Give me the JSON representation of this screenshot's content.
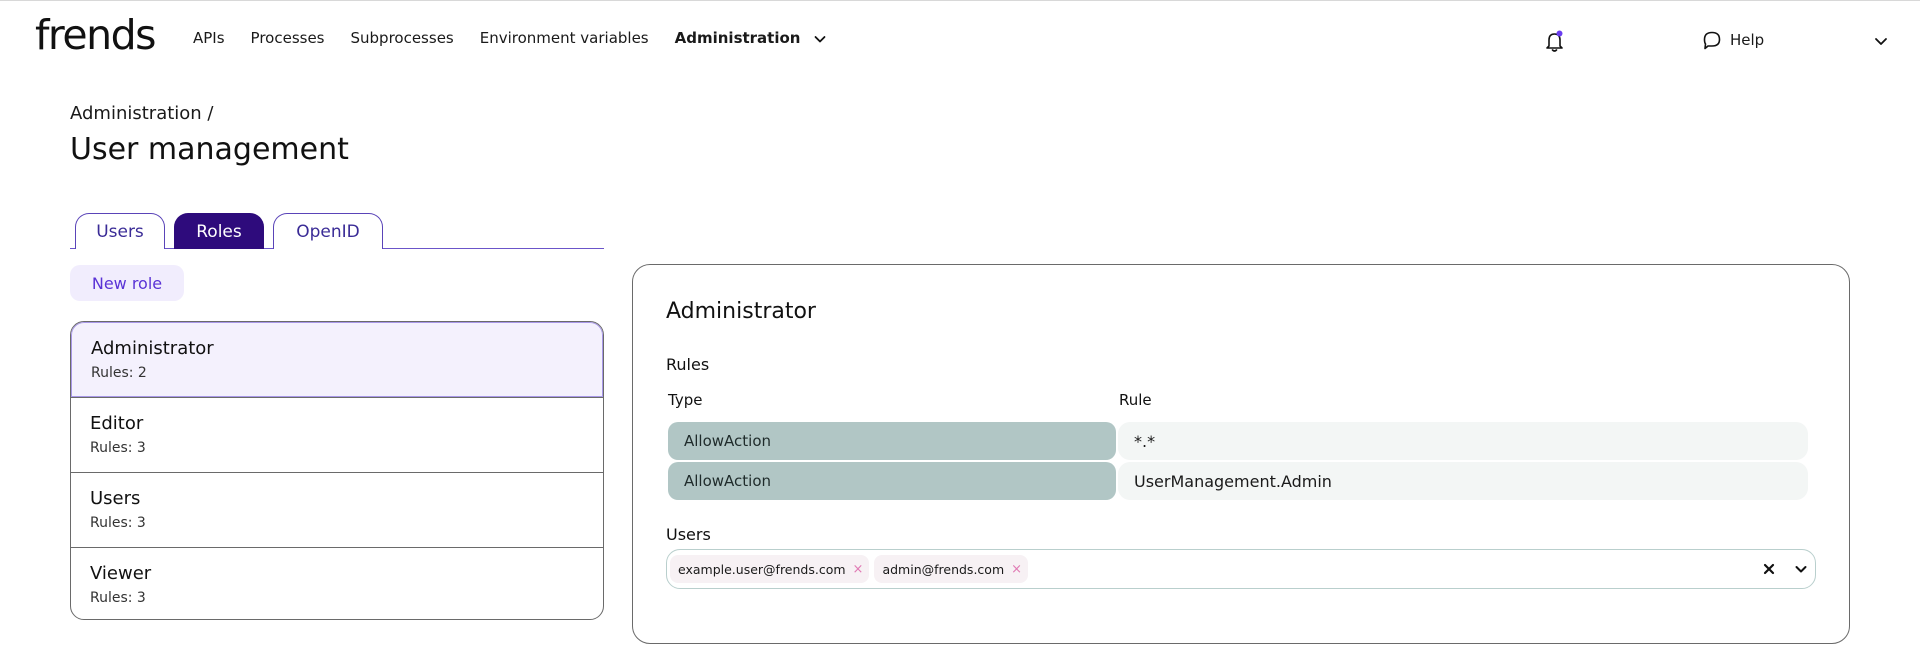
{
  "header": {
    "logo": "frends",
    "nav": [
      {
        "label": "APIs"
      },
      {
        "label": "Processes"
      },
      {
        "label": "Subprocesses"
      },
      {
        "label": "Environment variables"
      },
      {
        "label": "Administration",
        "active": true
      }
    ],
    "nav_dropdown_icon": "chevron-down-icon",
    "notification_icon": "bell-icon",
    "help_icon": "speech-bubble-icon",
    "help_label": "Help",
    "account_menu_icon": "chevron-down-icon"
  },
  "page": {
    "breadcrumb": "Administration /",
    "title": "User management"
  },
  "tabs": [
    {
      "label": "Users"
    },
    {
      "label": "Roles",
      "active": true
    },
    {
      "label": "OpenID"
    }
  ],
  "new_role_label": "New role",
  "roles": [
    {
      "name": "Administrator",
      "rules": "Rules: 2",
      "selected": true
    },
    {
      "name": "Editor",
      "rules": "Rules: 3"
    },
    {
      "name": "Users",
      "rules": "Rules: 3"
    },
    {
      "name": "Viewer",
      "rules": "Rules: 3"
    }
  ],
  "detail": {
    "title": "Administrator",
    "rules_label": "Rules",
    "columns": {
      "type": "Type",
      "rule": "Rule"
    },
    "rules": [
      {
        "type": "AllowAction",
        "rule": "*.*"
      },
      {
        "type": "AllowAction",
        "rule": "UserManagement.Admin"
      }
    ],
    "users_label": "Users",
    "users": [
      {
        "email": "example.user@frends.com",
        "remove": "×"
      },
      {
        "email": "admin@frends.com",
        "remove": "×"
      }
    ]
  },
  "colors": {
    "primary": "#2e0b7c",
    "accent": "#5a33d6",
    "type_pill": "#b1c6c5",
    "chip_remove": "#e07ab4"
  }
}
